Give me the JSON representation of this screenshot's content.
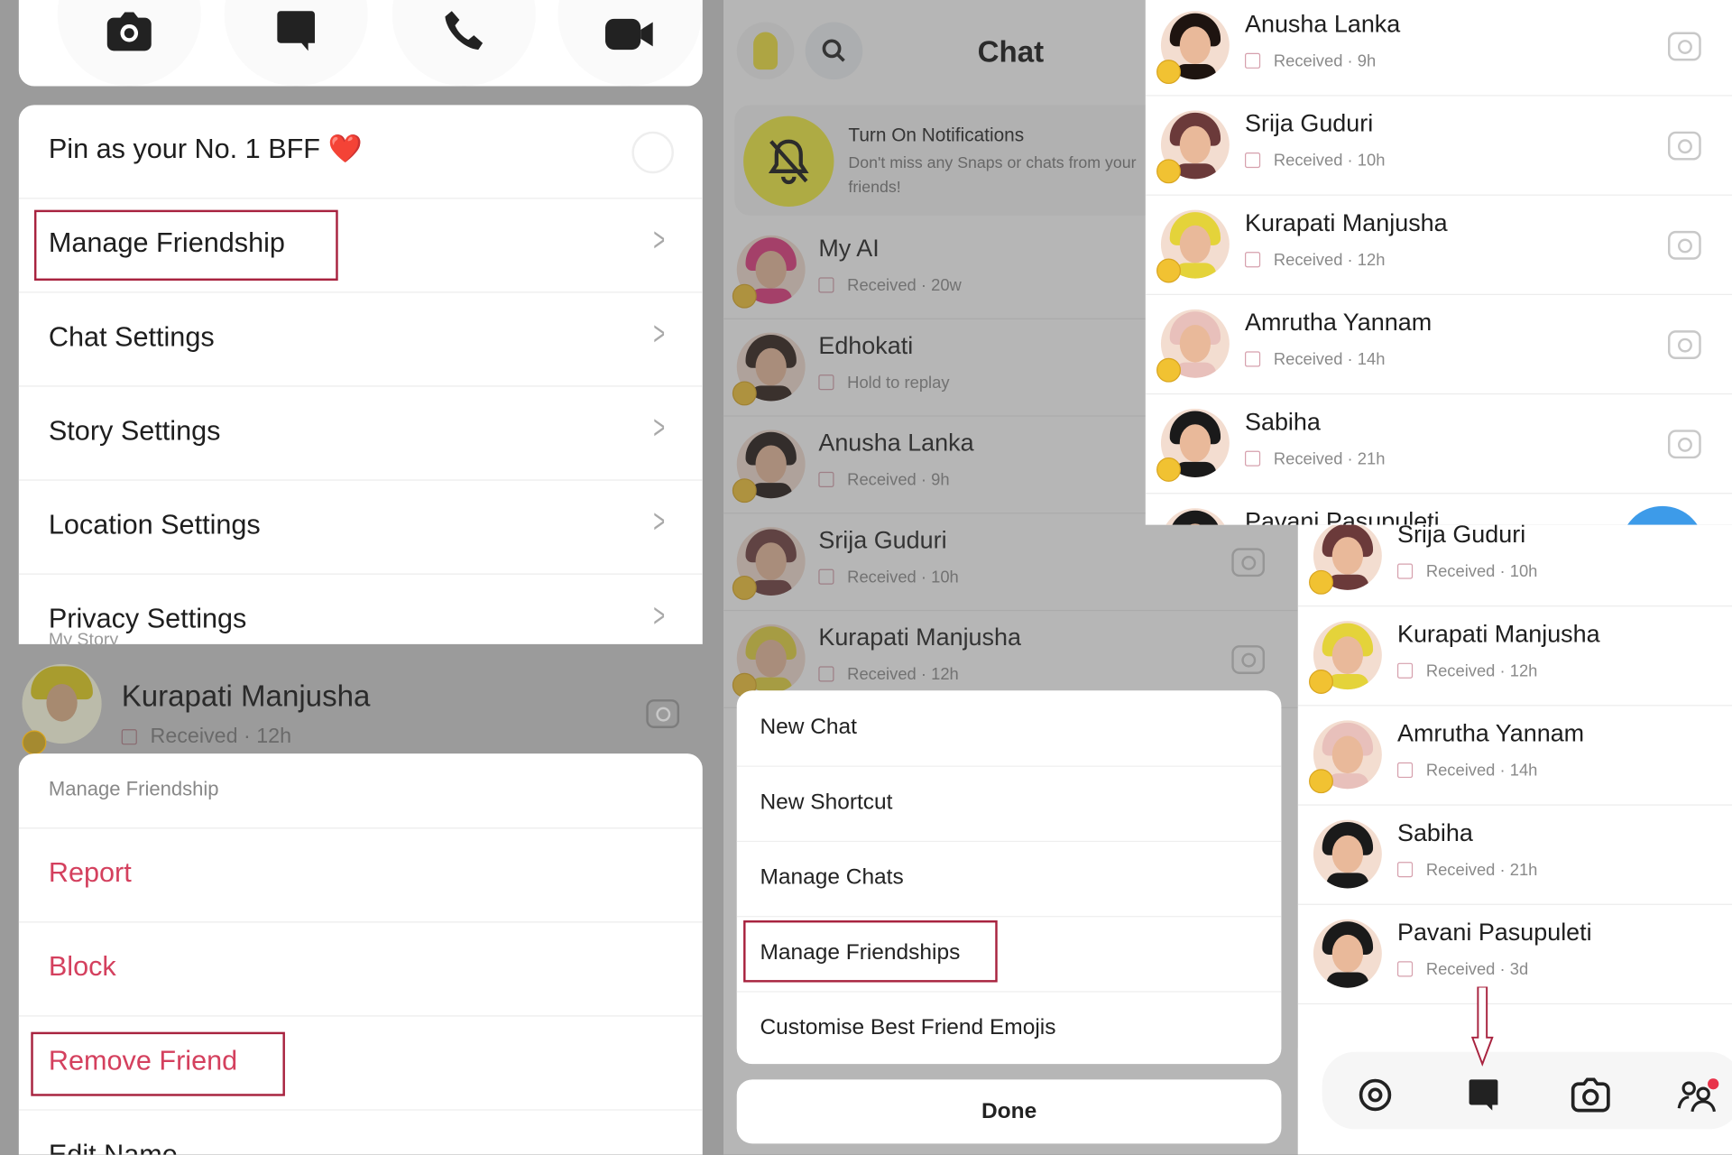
{
  "panel_actions": {
    "buttons": [
      {
        "icon": "camera-icon"
      },
      {
        "icon": "chat-icon"
      },
      {
        "icon": "phone-icon"
      },
      {
        "icon": "video-icon"
      }
    ]
  },
  "friend_settings": {
    "pin_label": "Pin as your No. 1 BFF",
    "pin_emoji": "❤️",
    "items": [
      "Manage Friendship",
      "Chat Settings",
      "Story Settings",
      "Location Settings",
      "Privacy Settings"
    ],
    "privacy_sub": "My Story",
    "highlighted": "Manage Friendship"
  },
  "background_row": {
    "name": "Kurapati Manjusha",
    "status": "Received",
    "time": "12h"
  },
  "manage_sheet": {
    "title": "Manage Friendship",
    "items": [
      "Report",
      "Block",
      "Remove Friend",
      "Edit Name"
    ],
    "highlighted": "Remove Friend",
    "danger_color": "#d4405e"
  },
  "chat_screen": {
    "title": "Chat",
    "notification": {
      "title": "Turn On Notifications",
      "body": "Don't miss any Snaps or chats from your friends!"
    },
    "rows": [
      {
        "name": "My AI",
        "status": "Received",
        "time": "20w",
        "hair": "#e0357a"
      },
      {
        "name": "Edhokati",
        "status": "Hold to replay",
        "time": "",
        "hair": "#2a1a14"
      },
      {
        "name": "Anusha Lanka",
        "status": "Received",
        "time": "9h",
        "hair": "#1e1410"
      },
      {
        "name": "Srija Guduri",
        "status": "Received",
        "time": "10h",
        "hair": "#6b3a3a"
      },
      {
        "name": "Kurapati Manjusha",
        "status": "Received",
        "time": "12h",
        "hair": "#e4d33a"
      }
    ]
  },
  "chat_menu": {
    "items": [
      "New Chat",
      "New Shortcut",
      "Manage Chats",
      "Manage Friendships",
      "Customise Best Friend Emojis"
    ],
    "highlighted": "Manage Friendships",
    "done_label": "Done"
  },
  "friends_list_top": {
    "rows": [
      {
        "name": "Anusha Lanka",
        "status": "Received",
        "time": "9h",
        "hair": "#1e1410"
      },
      {
        "name": "Srija Guduri",
        "status": "Received",
        "time": "10h",
        "hair": "#6b3a3a"
      },
      {
        "name": "Kurapati Manjusha",
        "status": "Received",
        "time": "12h",
        "hair": "#e4d33a"
      },
      {
        "name": "Amrutha Yannam",
        "status": "Received",
        "time": "14h",
        "hair": "#e8c0bb"
      },
      {
        "name": "Sabiha",
        "status": "Received",
        "time": "21h",
        "hair": "#1a1a1a"
      },
      {
        "name": "Pavani Pasupuleti",
        "status": "",
        "time": "",
        "hair": "#1a1a1a"
      }
    ]
  },
  "friends_list_bottom": {
    "rows": [
      {
        "name": "Srija Guduri",
        "status": "Received",
        "time": "10h",
        "hair": "#6b3a3a"
      },
      {
        "name": "Kurapati Manjusha",
        "status": "Received",
        "time": "12h",
        "hair": "#e4d33a"
      },
      {
        "name": "Amrutha Yannam",
        "status": "Received",
        "time": "14h",
        "hair": "#e8c0bb"
      },
      {
        "name": "Sabiha",
        "status": "Received",
        "time": "21h",
        "hair": "#1a1a1a"
      },
      {
        "name": "Pavani Pasupuleti",
        "status": "Received",
        "time": "3d",
        "hair": "#1a1a1a"
      }
    ],
    "nav": [
      {
        "icon": "map-pin-icon"
      },
      {
        "icon": "chat-icon",
        "active": true
      },
      {
        "icon": "camera-icon"
      },
      {
        "icon": "friends-icon",
        "badge": true
      }
    ]
  },
  "colors": {
    "highlight_box": "#a8233f",
    "snap_yellow": "#f2ec3c",
    "badge_red": "#e8334a",
    "fab_blue": "#3d9be9"
  }
}
